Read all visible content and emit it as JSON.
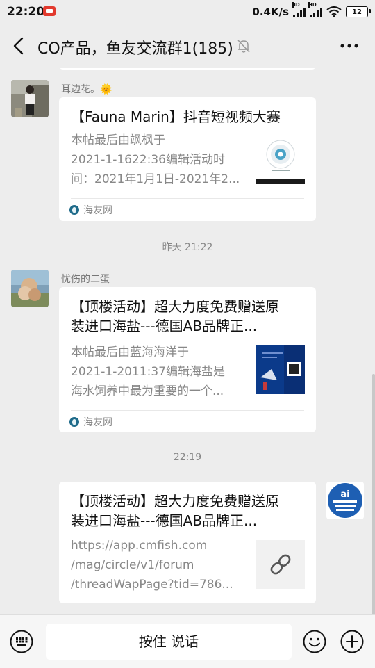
{
  "status_bar": {
    "time": "22:20",
    "network_speed": "0.4K/s",
    "hd_label": "HD",
    "battery": "12"
  },
  "header": {
    "title": "CO产品，鱼友交流群1(185)",
    "back_icon": "back-icon",
    "mute_icon": "bell-muted-icon",
    "more_icon": "more-icon"
  },
  "messages": [
    {
      "sender": "耳边花。🌞",
      "card": {
        "title": "【Fauna Marin】抖音短视频大赛",
        "desc_lines": [
          "本帖最后由飒枫于",
          "2021-1-1622:36编辑活动时",
          "间：2021年1月1日-2021年2..."
        ],
        "source": "海友网"
      }
    },
    {
      "timestamp": "昨天 21:22"
    },
    {
      "sender": "忧伤的二蛋",
      "card": {
        "title_lines": [
          "【顶楼活动】超大力度免费赠送原",
          "装进口海盐---德国AB品牌正..."
        ],
        "desc_lines": [
          "本帖最后由蓝海海洋于",
          "2021-1-2011:37编辑海盐是",
          "海水饲养中最为重要的一个..."
        ],
        "source": "海友网"
      }
    },
    {
      "timestamp": "22:19"
    },
    {
      "sender": "self",
      "card": {
        "title_lines": [
          "【顶楼活动】超大力度免费赠送原",
          "装进口海盐---德国AB品牌正..."
        ],
        "url_lines": [
          "https://app.cmfish.com",
          "/mag/circle/v1/forum",
          "/threadWapPage?tid=786..."
        ]
      }
    }
  ],
  "input_bar": {
    "hold_to_talk": "按住 说话",
    "keyboard_icon": "keyboard-icon",
    "emoji_icon": "emoji-icon",
    "plus_icon": "plus-icon"
  },
  "colors": {
    "background": "#ededed",
    "card": "#ffffff",
    "secondary_text": "#888888"
  }
}
